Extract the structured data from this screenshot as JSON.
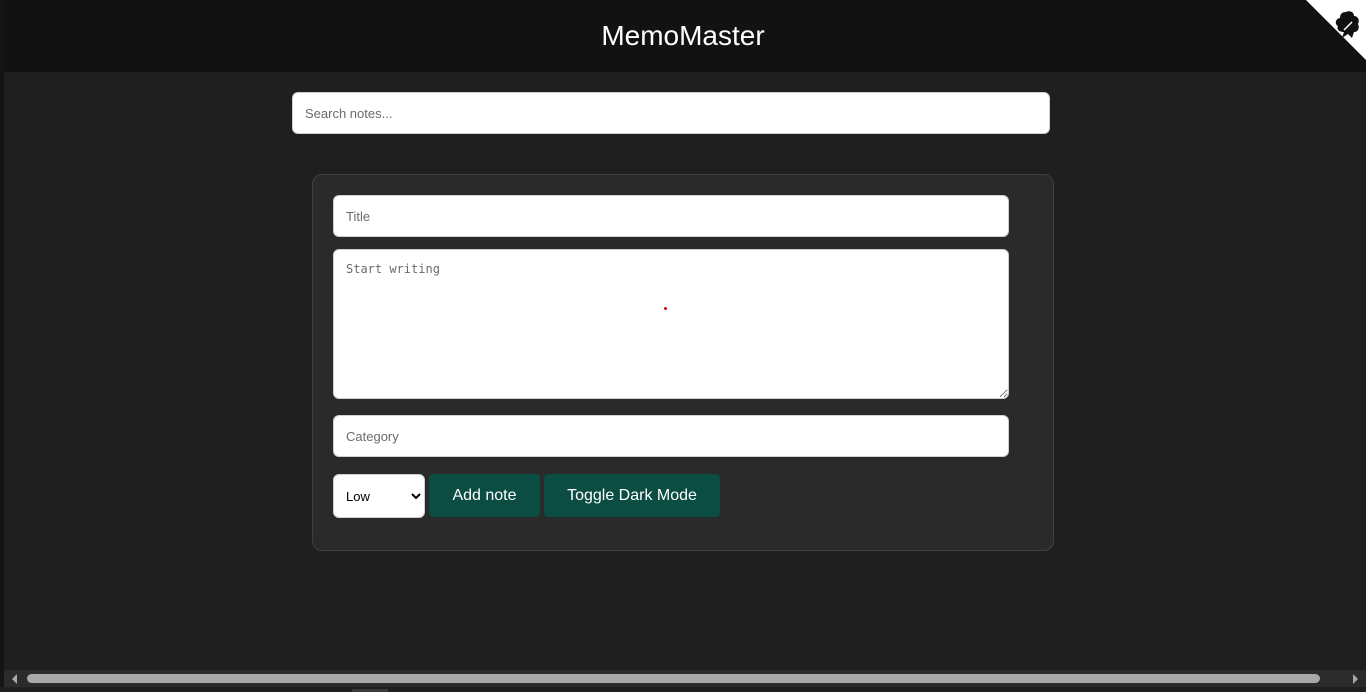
{
  "app": {
    "title": "MemoMaster"
  },
  "search": {
    "placeholder": "Search notes..."
  },
  "note_form": {
    "title_placeholder": "Title",
    "content_placeholder": "Start writing",
    "category_placeholder": "Category",
    "priority": {
      "selected": "Low",
      "options": [
        "Low"
      ]
    },
    "add_label": "Add note",
    "toggle_label": "Toggle Dark Mode"
  },
  "icons": {
    "corner": "fork-corner-icon"
  },
  "colors": {
    "header_bg": "#121212",
    "page_bg": "#1f1f1f",
    "card_bg": "#2a2a2a",
    "button_bg": "#0b4d42",
    "button_text": "#ffffff"
  }
}
